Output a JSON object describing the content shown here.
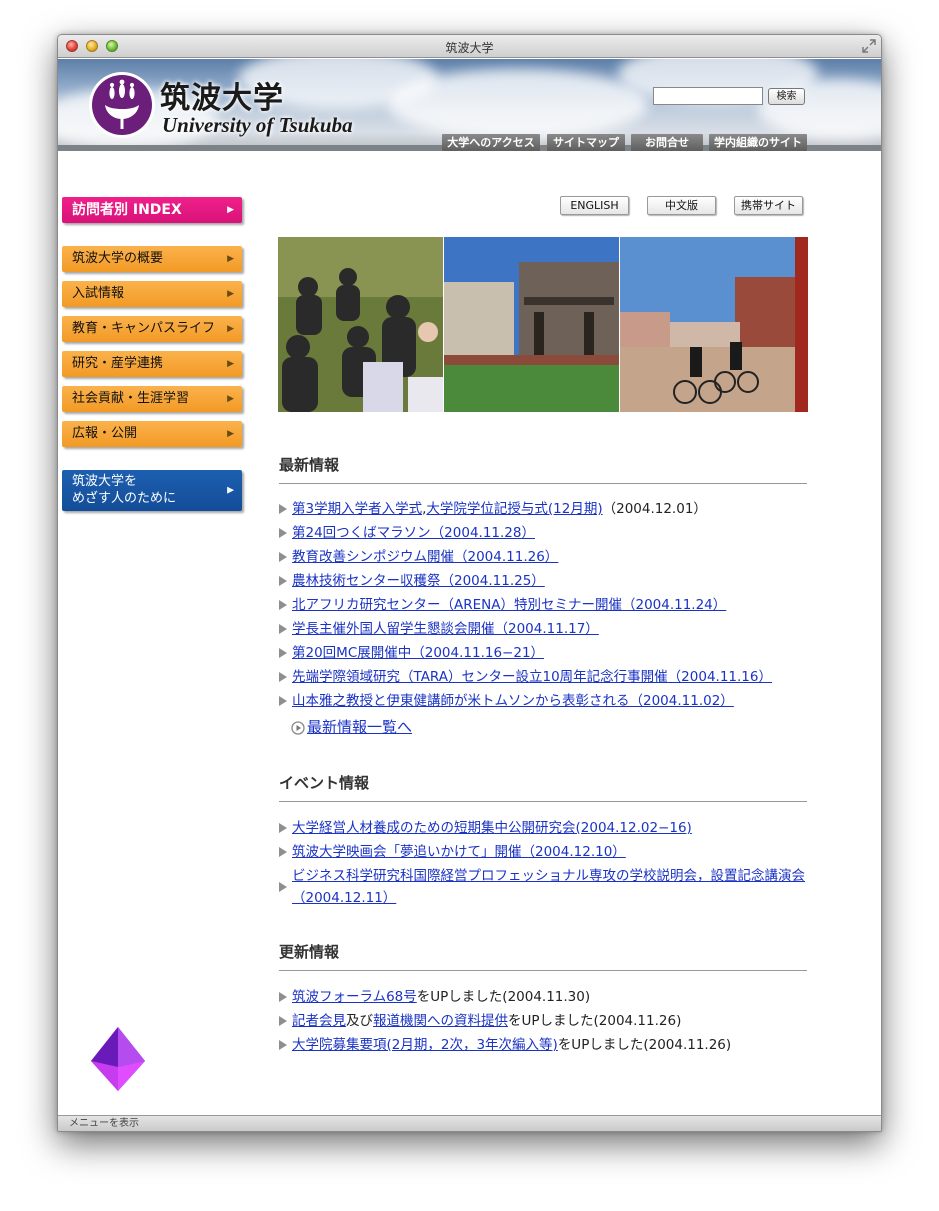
{
  "window": {
    "title": "筑波大学"
  },
  "header": {
    "logo_jp": "筑波大学",
    "logo_en": "University of Tsukuba",
    "search_placeholder": "",
    "search_button": "検索",
    "nav": [
      "大学へのアクセス",
      "サイトマップ",
      "お問合せ",
      "学内組織のサイト"
    ]
  },
  "sidebar": {
    "index_label": "訪問者別 INDEX",
    "items": [
      "筑波大学の概要",
      "入試情報",
      "教育・キャンパスライフ",
      "研究・産学連携",
      "社会貢献・生涯学習",
      "広報・公開"
    ],
    "prospective_line1": "筑波大学を",
    "prospective_line2": "めざす人のために"
  },
  "lang": [
    "ENGLISH",
    "中文版",
    "携帯サイト"
  ],
  "news": {
    "title": "最新情報",
    "items": [
      {
        "link": "第3学期入学者入学式",
        "sep": ",",
        "link2": "大学院学位記授与式(12月期)",
        "tail": "（2004.12.01）"
      },
      {
        "link": "第24回つくばマラソン（2004.11.28）"
      },
      {
        "link": "教育改善シンポジウム開催（2004.11.26）"
      },
      {
        "link": "農林技術センター収穫祭（2004.11.25）"
      },
      {
        "link": "北アフリカ研究センター（ARENA）特別セミナー開催（2004.11.24）"
      },
      {
        "link": "学長主催外国人留学生懇談会開催（2004.11.17）"
      },
      {
        "link": "第20回MC展開催中（2004.11.16−21）"
      },
      {
        "link": "先端学際領域研究（TARA）センター設立10周年記念行事開催（2004.11.16）"
      },
      {
        "link": "山本雅之教授と伊東健講師が米トムソンから表彰される（2004.11.02）"
      }
    ],
    "more": " 最新情報一覧へ"
  },
  "events": {
    "title": "イベント情報",
    "items": [
      "大学経営人材養成のための短期集中公開研究会(2004.12.02−16)",
      "筑波大学映画会「夢追いかけて」開催（2004.12.10）",
      "ビジネス科学研究科国際経営プロフェッショナル専攻の学校説明会，設置記念講演会（2004.12.11）"
    ]
  },
  "updates": {
    "title": "更新情報",
    "items": [
      {
        "link": "筑波フォーラム68号",
        "tail": "をUPしました(2004.11.30)"
      },
      {
        "link": "記者会見",
        "mid": "及び",
        "link2": "報道機関への資料提供",
        "tail": "をUPしました(2004.11.26)"
      },
      {
        "link": "大学院募集要項(2月期，2次，3年次編入等)",
        "tail": "をUPしました(2004.11.26)"
      }
    ]
  },
  "status": "メニューを表示"
}
